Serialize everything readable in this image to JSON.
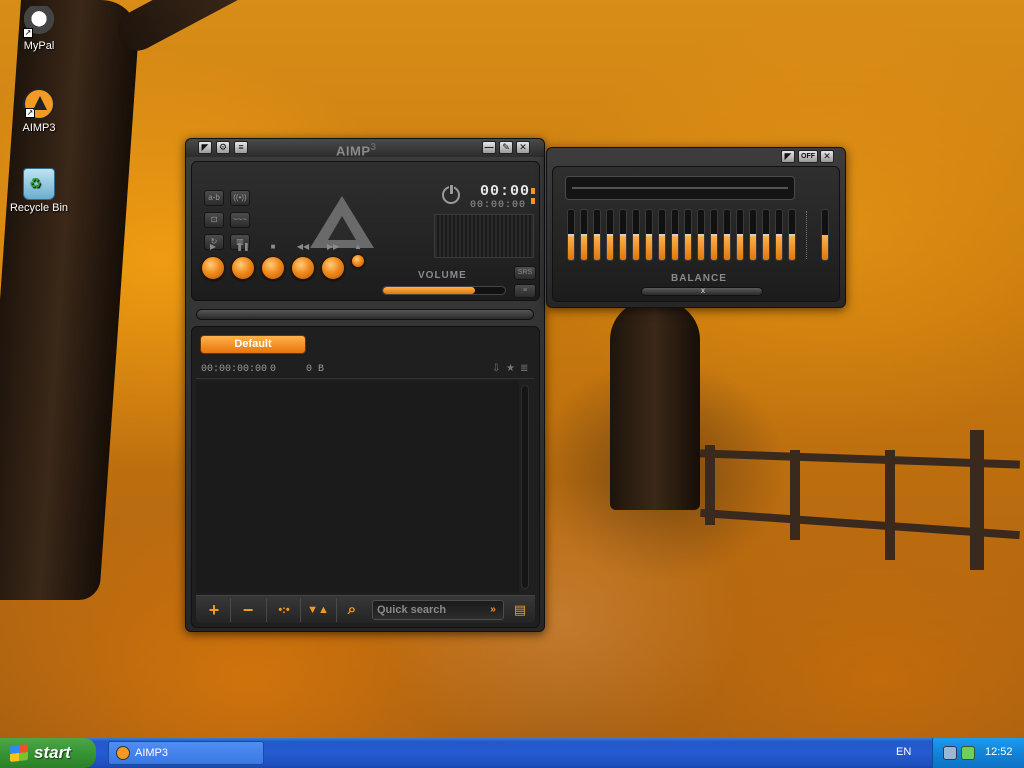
{
  "desktop": {
    "icons": [
      {
        "label": "MyPal",
        "icon": "mypal-icon"
      },
      {
        "label": "AIMP3",
        "icon": "aimp-icon"
      },
      {
        "label": "Recycle Bin",
        "icon": "recycle-bin-icon"
      }
    ]
  },
  "player": {
    "title": "AIMP",
    "title_suffix": "3",
    "time_main": "00:00",
    "time_sub": "00:00:00",
    "volume_label": "VOLUME",
    "volume_level": 0.75,
    "mini_buttons": [
      "SRS",
      "≡"
    ],
    "left_buttons": [
      "a-b",
      "((•))",
      "⊡",
      "~~~",
      "↻",
      "▥"
    ],
    "transport_symbols": [
      "▶",
      "❚❚",
      "■",
      "◀◀",
      "▶▶",
      "▲"
    ],
    "titlebar_left_buttons": [
      "◤",
      "⚙",
      "≡"
    ],
    "titlebar_right_buttons": [
      "—",
      "✎",
      "✕"
    ]
  },
  "playlist": {
    "tab_label": "Default",
    "info_duration": "00:00:00:00",
    "info_count": "0",
    "info_size": "0 B",
    "search_placeholder": "Quick search",
    "search_go": "»",
    "toolbar": [
      "+",
      "−",
      "•:•",
      "▼▲",
      "⌕",
      "▤"
    ]
  },
  "equalizer": {
    "off_label": "OFF",
    "balance_label": "BALANCE",
    "band_levels": [
      0.5,
      0.5,
      0.5,
      0.5,
      0.5,
      0.5,
      0.5,
      0.5,
      0.5,
      0.5,
      0.5,
      0.5,
      0.5,
      0.5,
      0.5,
      0.5,
      0.5,
      0.5
    ],
    "preamp_level": 0.5,
    "balance_knob": "x"
  },
  "taskbar": {
    "start_label": "start",
    "task_label": "AIMP3",
    "language": "EN",
    "clock": "12:52"
  },
  "colors": {
    "accent": "#f39a23",
    "taskbar_blue": "#245bd3",
    "start_green": "#379532"
  }
}
